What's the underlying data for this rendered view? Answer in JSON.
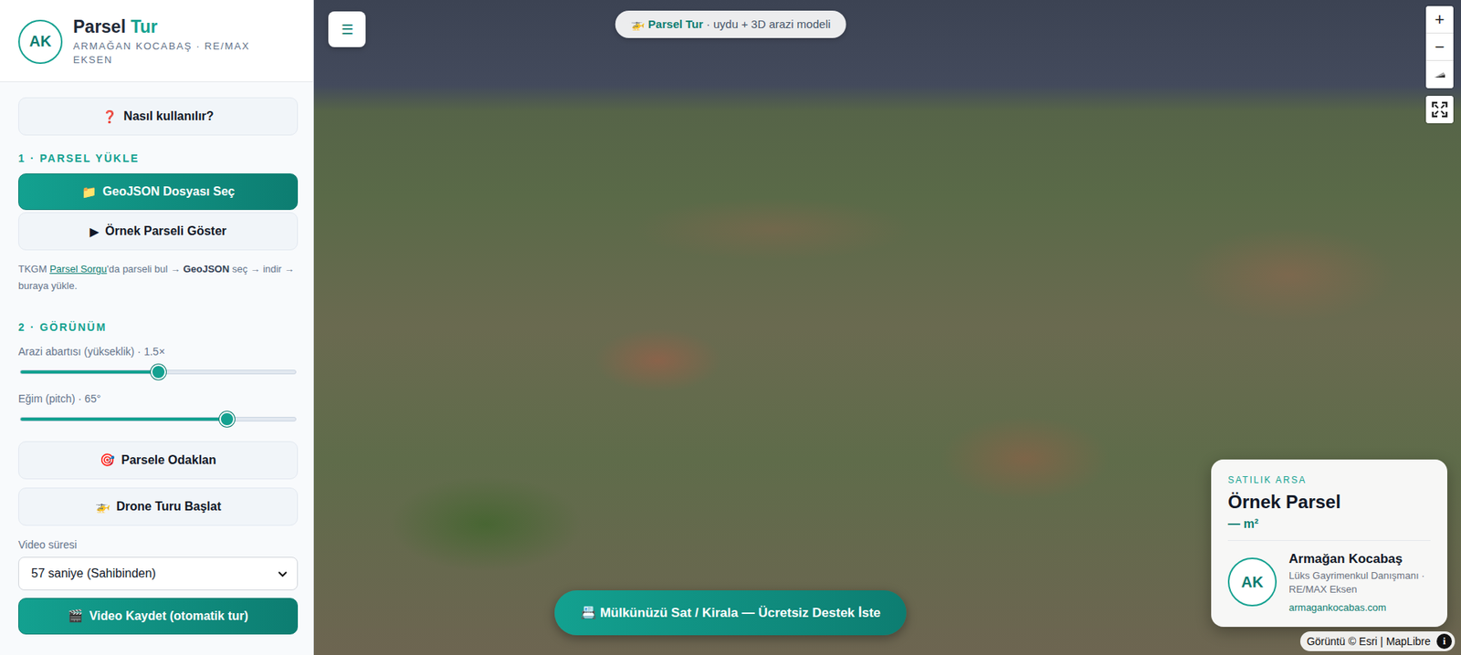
{
  "sidebar": {
    "logo": "AK",
    "title": {
      "main": "Parsel",
      "accent": "Tur"
    },
    "subtitle": "ARMAĞAN KOCABAŞ · RE/MAX EKSEN",
    "help_button": {
      "icon": "❓",
      "label": "Nasıl kullanılır?"
    },
    "section_upload": {
      "title": "1 · PARSEL YÜKLE",
      "buttons": [
        {
          "icon": "📁",
          "label": "GeoJSON Dosyası Seç",
          "kind": "primary"
        },
        {
          "icon": "▶",
          "label": "Örnek Parseli Göster",
          "kind": "secondary"
        }
      ],
      "hint": [
        {
          "text": "TKGM ",
          "kind": "plain"
        },
        {
          "text": "Parsel Sorgu",
          "kind": "link"
        },
        {
          "text": "'da parseli bul → ",
          "kind": "plain"
        },
        {
          "text": "GeoJSON",
          "kind": "bold"
        },
        {
          "text": " seç → indir → buraya yükle.",
          "kind": "plain"
        }
      ]
    },
    "section_view": {
      "title": "2 · GÖRÜNÜM",
      "sliders": [
        {
          "label": "Arazi abartısı (yükseklik) · 1.5×",
          "level": 0.5
        },
        {
          "label": "Eğim (pitch) · 65°",
          "level": 0.75
        }
      ],
      "buttons": [
        {
          "icon": "🎯",
          "label": "Parsele Odaklan",
          "kind": "secondary"
        },
        {
          "icon": "🚁",
          "label": "Drone Turu Başlat",
          "kind": "secondary"
        }
      ],
      "duration": {
        "label": "Video süresi",
        "value": "57 saniye (Sahibinden)"
      },
      "record_button": {
        "icon": "🎬",
        "label": "Video Kaydet (otomatik tur)",
        "kind": "primary"
      }
    }
  },
  "map": {
    "menu_button": "☰",
    "title_pill": {
      "icon": "🚁",
      "strong": "Parsel Tur",
      "rest": " · uydu + 3D arazi modeli"
    },
    "controls": {
      "zoom_in": "+",
      "zoom_out": "−"
    },
    "cta": {
      "icon": "📇",
      "label": "Mülkünüzü Sat / Kirala — Ücretsiz Destek İste"
    },
    "attribution": {
      "text": "Görüntü © Esri | MapLibre",
      "info": "i"
    },
    "card": {
      "eyebrow": "SATILIK ARSA",
      "title": "Örnek Parsel",
      "area": "— m²",
      "agent": {
        "initials": "AK",
        "name": "Armağan Kocabaş",
        "role": "Lüks Gayrimenkul Danışmanı · RE/MAX Eksen",
        "site": "armagankocabas.com"
      }
    }
  }
}
